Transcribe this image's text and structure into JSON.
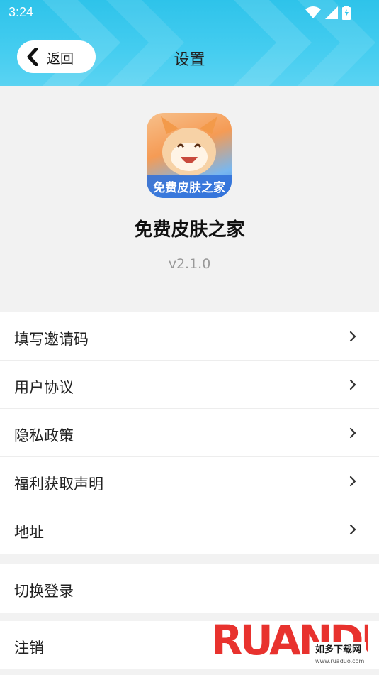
{
  "status_bar": {
    "time": "3:24"
  },
  "header": {
    "back_label": "返回",
    "title": "设置"
  },
  "app": {
    "name": "免费皮肤之家",
    "version": "v2.1.0",
    "icon_text": "免费皮肤之家"
  },
  "menu_group_1": [
    {
      "label": "填写邀请码"
    },
    {
      "label": "用户协议"
    },
    {
      "label": "隐私政策"
    },
    {
      "label": "福利获取声明"
    },
    {
      "label": "地址"
    }
  ],
  "menu_group_2": [
    {
      "label": "切换登录"
    }
  ],
  "menu_group_3": [
    {
      "label": "注销"
    }
  ],
  "watermark": {
    "brand": "RUANDUO",
    "sub": "如多下载网",
    "url": "www.ruaduo.com"
  },
  "colors": {
    "header": "#36c6ec",
    "page_bg": "#f2f2f2",
    "row_bg": "#ffffff"
  }
}
